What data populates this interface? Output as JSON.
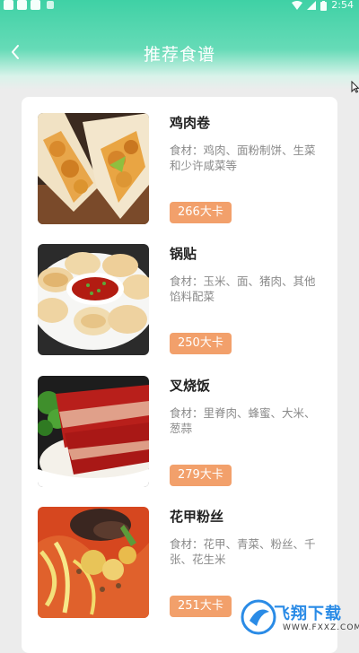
{
  "status_bar": {
    "time": "2:54"
  },
  "header": {
    "title": "推荐食谱"
  },
  "recipes": [
    {
      "name": "鸡肉卷",
      "ingredients": "食材：鸡肉、面粉制饼、生菜和少许咸菜等",
      "calories": "266大卡",
      "image": "chicken-wrap"
    },
    {
      "name": "锅贴",
      "ingredients": "食材：玉米、面、猪肉、其他馅料配菜",
      "calories": "250大卡",
      "image": "potstickers"
    },
    {
      "name": "叉烧饭",
      "ingredients": "食材：里脊肉、蜂蜜、大米、葱蒜",
      "calories": "279大卡",
      "image": "char-siu-rice"
    },
    {
      "name": "花甲粉丝",
      "ingredients": "食材：花甲、青菜、粉丝、千张、花生米",
      "calories": "251大卡",
      "image": "clam-noodles"
    }
  ],
  "watermark": {
    "title": "飞翔下载",
    "subtitle": "WWW.FXXZ.COM"
  },
  "colors": {
    "header": "#3fd1a5",
    "calorie_badge": "#f2a06b",
    "background": "#ececec"
  }
}
